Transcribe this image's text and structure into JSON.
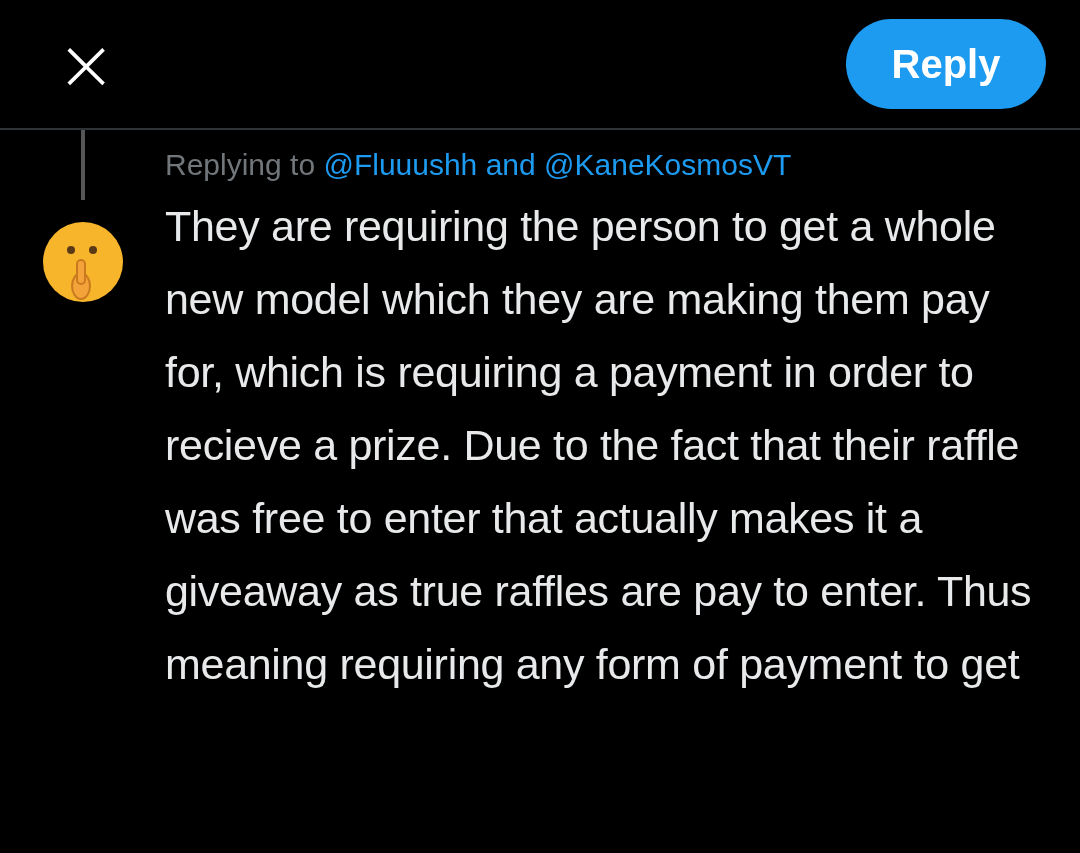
{
  "header": {
    "close_icon": "×",
    "reply_button": "Reply"
  },
  "replying_to": {
    "prefix": "Replying to",
    "handles": [
      "@Fluuushh",
      "@KaneKosmosVT"
    ],
    "joiner": "and"
  },
  "reply_text": "They are requiring the person to get a whole new model which they are making them pay for, which is requiring a payment in order to recieve a prize. Due to the fact that their raffle was free to enter that actually makes it a giveaway as true raffles are pay to enter. Thus meaning requiring any form of payment to get"
}
